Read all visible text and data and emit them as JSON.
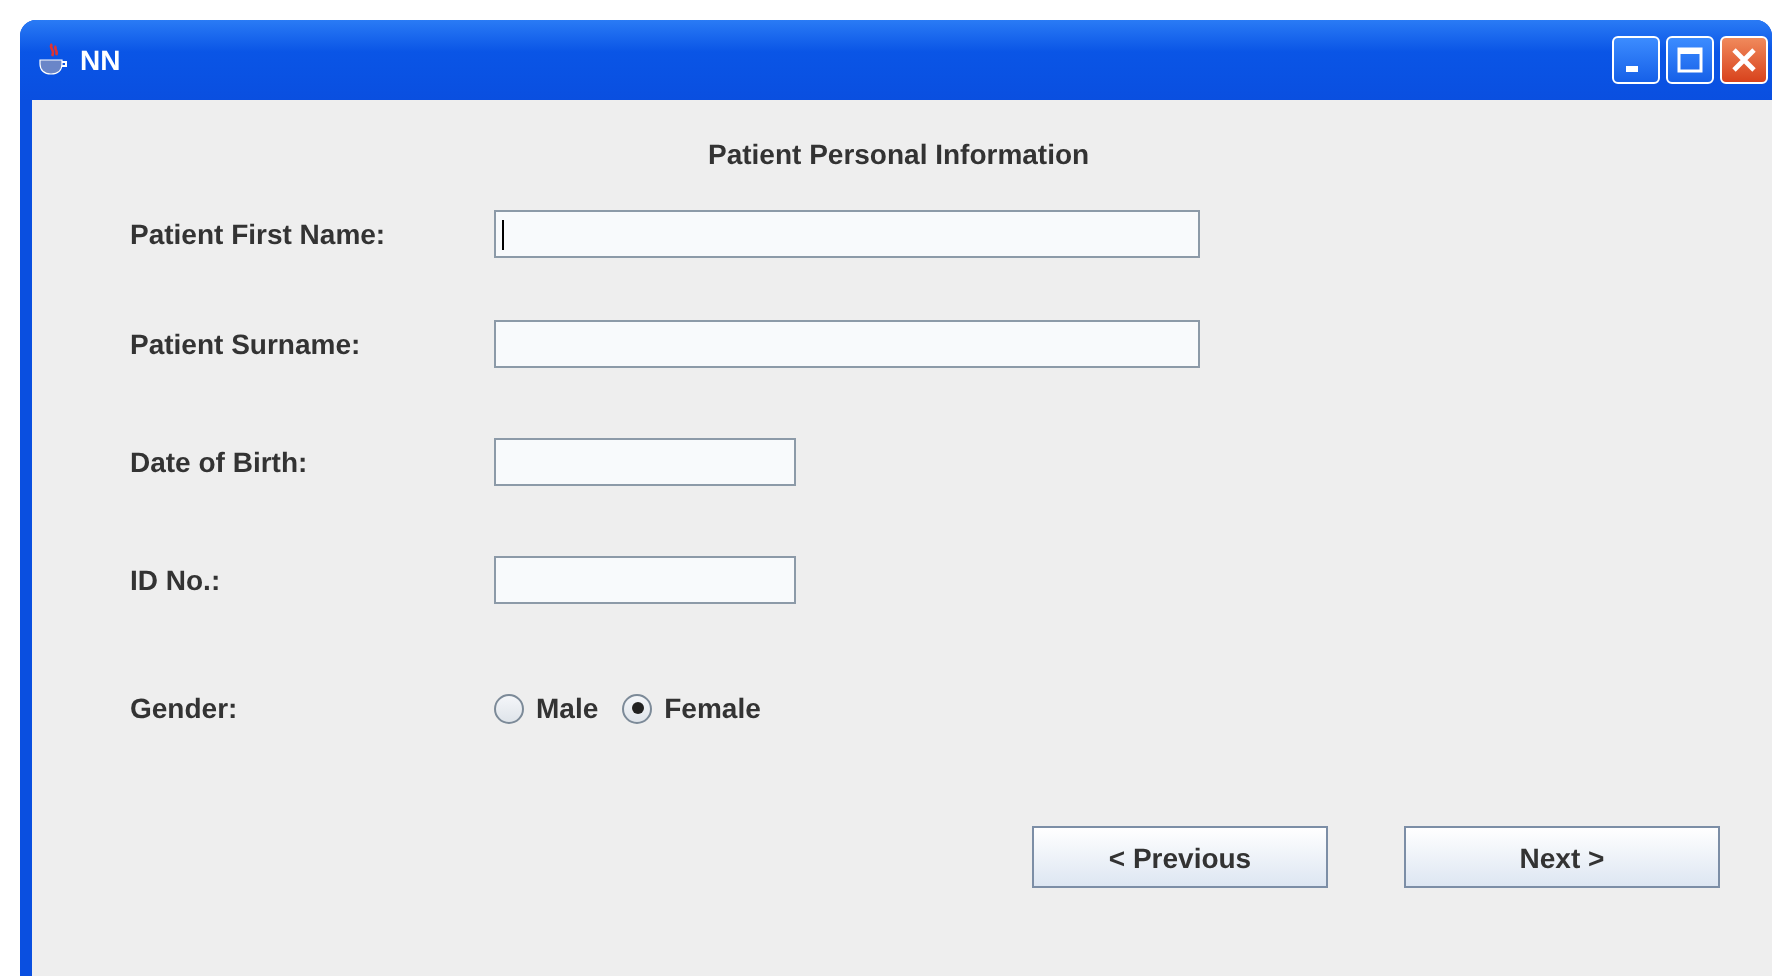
{
  "window": {
    "title": "NN"
  },
  "heading": "Patient Personal Information",
  "fields": [
    {
      "label": "Patient First Name:",
      "focused": true
    },
    {
      "label": "Patient Surname:",
      "focused": false
    },
    {
      "label": "Date of Birth:",
      "focused": false
    },
    {
      "label": "ID No.:",
      "focused": false
    }
  ],
  "gender": {
    "label": "Gender:",
    "options": [
      {
        "label": "Male",
        "selected": false
      },
      {
        "label": "Female",
        "selected": true
      }
    ]
  },
  "buttons": [
    "< Previous",
    "Next >"
  ]
}
